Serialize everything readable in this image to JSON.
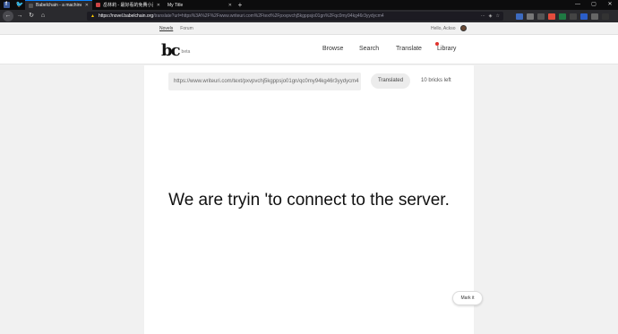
{
  "browser": {
    "tabs": [
      {
        "title": "Babelchain - a machine transl",
        "active": true
      },
      {
        "title": "岳林莉 - 最好看的免費小說網站",
        "active": false
      },
      {
        "title": "My Title",
        "active": false
      }
    ],
    "new_tab": "+",
    "url_host": "https://novel.babelchain.org",
    "url_path": "/translate?url=https%3A%2F%2Fwww.writeuri.com%2Ftext%2Fpxvpvchj5kgppsjo01gn%2Fqc0my94kg46r3yydycm4",
    "window_controls": [
      "—",
      "▢",
      "✕"
    ],
    "accent_color": "#0a84ff"
  },
  "site": {
    "topnav": {
      "novels": "Novels",
      "forum": "Forum",
      "greeting": "Hello, Ackso"
    },
    "logo_mark": "bc",
    "logo_badge": "beta",
    "nav": {
      "browse": "Browse",
      "search": "Search",
      "translate": "Translate",
      "library": "Library"
    },
    "url_input_value": "https://www.writeuri.com/text/pxvpvchj5kgppsjo01gn/qc0my94kg46r3yydycm4",
    "translated_button": "Translated",
    "bricks_left": "10 bricks left",
    "message": "We are tryin 'to connect to the server.",
    "mark_it_button": "Mark it",
    "library_dot_color": "#e0322c"
  }
}
